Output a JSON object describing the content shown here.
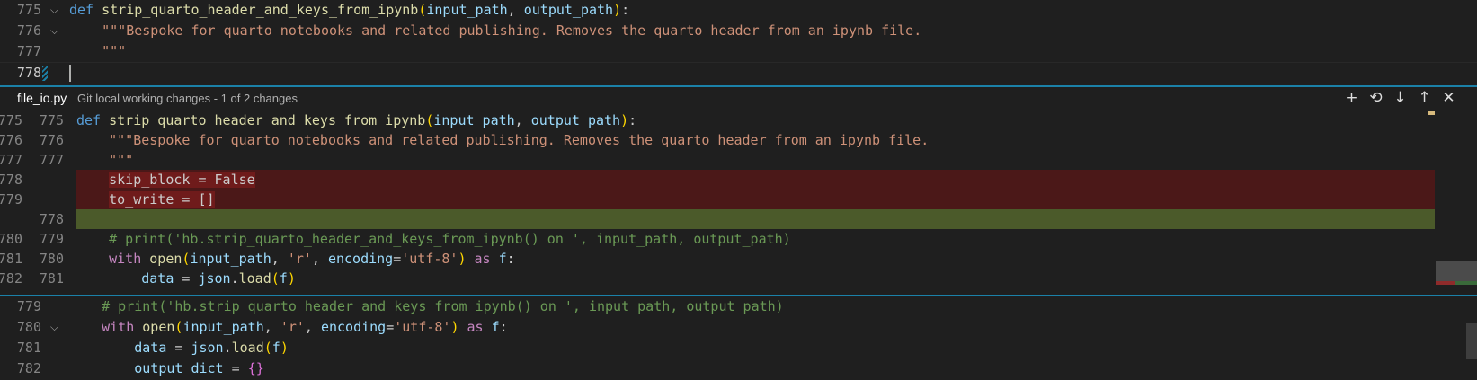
{
  "top_editor": {
    "lines": [
      {
        "num": "775",
        "fold": "v",
        "tokens": [
          [
            "kw",
            "def "
          ],
          [
            "fn",
            "strip_quarto_header_and_keys_from_ipynb"
          ],
          [
            "br",
            "("
          ],
          [
            "param",
            "input_path"
          ],
          [
            "pl",
            ", "
          ],
          [
            "param",
            "output_path"
          ],
          [
            "br",
            ")"
          ],
          [
            "pl",
            ":"
          ]
        ]
      },
      {
        "num": "776",
        "fold": "v",
        "tokens": [
          [
            "str",
            "    \"\"\"Bespoke for quarto notebooks and related publishing. Removes the quarto header from an ipynb file."
          ]
        ]
      },
      {
        "num": "777",
        "fold": "",
        "tokens": [
          [
            "str",
            "    \"\"\""
          ]
        ]
      },
      {
        "num": "778",
        "fold": "",
        "tokens": []
      }
    ]
  },
  "peek": {
    "file_name": "file_io.py",
    "description": "Git local working changes - 1 of 2 changes",
    "actions": [
      {
        "name": "stage-change-icon",
        "glyph": "+"
      },
      {
        "name": "revert-change-icon",
        "glyph": "⟲"
      },
      {
        "name": "next-change-icon",
        "glyph": "↓"
      },
      {
        "name": "previous-change-icon",
        "glyph": "↑"
      },
      {
        "name": "close-icon",
        "glyph": "✕"
      }
    ],
    "lines": [
      {
        "type": "ctx",
        "old": "775",
        "new": "775",
        "tokens": [
          [
            "kw",
            "def "
          ],
          [
            "fn",
            "strip_quarto_header_and_keys_from_ipynb"
          ],
          [
            "br",
            "("
          ],
          [
            "param",
            "input_path"
          ],
          [
            "pl",
            ", "
          ],
          [
            "param",
            "output_path"
          ],
          [
            "br",
            ")"
          ],
          [
            "pl",
            ":"
          ]
        ]
      },
      {
        "type": "ctx",
        "old": "776",
        "new": "776",
        "tokens": [
          [
            "str",
            "    \"\"\"Bespoke for quarto notebooks and related publishing. Removes the quarto header from an ipynb file."
          ]
        ]
      },
      {
        "type": "ctx",
        "old": "777",
        "new": "777",
        "tokens": [
          [
            "str",
            "    \"\"\""
          ]
        ]
      },
      {
        "type": "del",
        "old": "778",
        "new": "",
        "tokens": [
          [
            "pl",
            "    "
          ],
          [
            "hl",
            "skip_block = False"
          ]
        ]
      },
      {
        "type": "del",
        "old": "779",
        "new": "",
        "tokens": [
          [
            "pl",
            "    "
          ],
          [
            "hl",
            "to_write = []"
          ]
        ]
      },
      {
        "type": "ins",
        "old": "",
        "new": "778",
        "tokens": []
      },
      {
        "type": "ctx",
        "old": "780",
        "new": "779",
        "tokens": [
          [
            "cm",
            "    # print('hb.strip_quarto_header_and_keys_from_ipynb() on ', input_path, output_path)"
          ]
        ]
      },
      {
        "type": "ctx",
        "old": "781",
        "new": "780",
        "tokens": [
          [
            "kw2",
            "    with "
          ],
          [
            "fn",
            "open"
          ],
          [
            "br",
            "("
          ],
          [
            "param",
            "input_path"
          ],
          [
            "pl",
            ", "
          ],
          [
            "str",
            "'r'"
          ],
          [
            "pl",
            ", "
          ],
          [
            "param",
            "encoding"
          ],
          [
            "pl",
            "="
          ],
          [
            "str",
            "'utf-8'"
          ],
          [
            "br",
            ")"
          ],
          [
            "kw2",
            " as "
          ],
          [
            "param",
            "f"
          ],
          [
            "pl",
            ":"
          ]
        ]
      },
      {
        "type": "ctx",
        "old": "782",
        "new": "781",
        "tokens": [
          [
            "param",
            "        data"
          ],
          [
            "pl",
            " = "
          ],
          [
            "param",
            "json"
          ],
          [
            "pl",
            "."
          ],
          [
            "fn",
            "load"
          ],
          [
            "br",
            "("
          ],
          [
            "param",
            "f"
          ],
          [
            "br",
            ")"
          ]
        ]
      }
    ]
  },
  "bottom_editor": {
    "lines": [
      {
        "num": "779",
        "fold": "",
        "tokens": [
          [
            "cm",
            "    # print('hb.strip_quarto_header_and_keys_from_ipynb() on ', input_path, output_path)"
          ]
        ]
      },
      {
        "num": "780",
        "fold": "v",
        "tokens": [
          [
            "kw2",
            "    with "
          ],
          [
            "fn",
            "open"
          ],
          [
            "br",
            "("
          ],
          [
            "param",
            "input_path"
          ],
          [
            "pl",
            ", "
          ],
          [
            "str",
            "'r'"
          ],
          [
            "pl",
            ", "
          ],
          [
            "param",
            "encoding"
          ],
          [
            "pl",
            "="
          ],
          [
            "str",
            "'utf-8'"
          ],
          [
            "br",
            ")"
          ],
          [
            "kw2",
            " as "
          ],
          [
            "param",
            "f"
          ],
          [
            "pl",
            ":"
          ]
        ]
      },
      {
        "num": "781",
        "fold": "",
        "tokens": [
          [
            "param",
            "        data"
          ],
          [
            "pl",
            " = "
          ],
          [
            "param",
            "json"
          ],
          [
            "pl",
            "."
          ],
          [
            "fn",
            "load"
          ],
          [
            "br",
            "("
          ],
          [
            "param",
            "f"
          ],
          [
            "br",
            ")"
          ]
        ]
      },
      {
        "num": "782",
        "fold": "",
        "tokens": [
          [
            "param",
            "        output_dict"
          ],
          [
            "pl",
            " = "
          ],
          [
            "br2",
            "{}"
          ]
        ]
      }
    ]
  }
}
